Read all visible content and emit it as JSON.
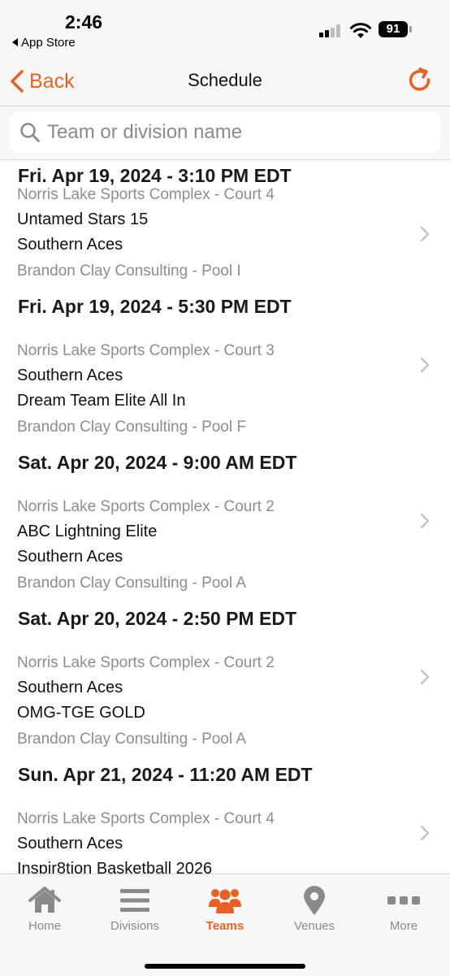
{
  "status_bar": {
    "time": "2:46",
    "back_app_label": "App Store",
    "battery": "91"
  },
  "nav": {
    "back_label": "Back",
    "title": "Schedule"
  },
  "search": {
    "placeholder": "Team or division name",
    "value": ""
  },
  "games": [
    {
      "datetime": "Fri. Apr 19, 2024 - 3:10 PM EDT",
      "venue": "Norris Lake Sports Complex - Court 4",
      "team1": "Untamed Stars 15",
      "team2": "Southern Aces",
      "pool": "Brandon Clay Consulting - Pool I"
    },
    {
      "datetime": "Fri. Apr 19, 2024 - 5:30 PM EDT",
      "venue": "Norris Lake Sports Complex - Court 3",
      "team1": "Southern Aces",
      "team2": "Dream Team Elite All In",
      "pool": "Brandon Clay Consulting - Pool F"
    },
    {
      "datetime": "Sat. Apr 20, 2024 - 9:00 AM EDT",
      "venue": "Norris Lake Sports Complex - Court 2",
      "team1": "ABC Lightning Elite",
      "team2": "Southern Aces",
      "pool": "Brandon Clay Consulting - Pool A"
    },
    {
      "datetime": "Sat. Apr 20, 2024 - 2:50 PM EDT",
      "venue": "Norris Lake Sports Complex - Court 2",
      "team1": "Southern Aces",
      "team2": "OMG-TGE GOLD",
      "pool": "Brandon Clay Consulting - Pool A"
    },
    {
      "datetime": "Sun. Apr 21, 2024 - 11:20 AM EDT",
      "venue": "Norris Lake Sports Complex - Court 4",
      "team1": "Southern Aces",
      "team2": "Inspir8tion Basketball 2026",
      "pool": ""
    }
  ],
  "tabs": [
    {
      "label": "Home",
      "icon": "home-icon",
      "active": false
    },
    {
      "label": "Divisions",
      "icon": "list-icon",
      "active": false
    },
    {
      "label": "Teams",
      "icon": "teams-icon",
      "active": true
    },
    {
      "label": "Venues",
      "icon": "map-pin-icon",
      "active": false
    },
    {
      "label": "More",
      "icon": "more-icon",
      "active": false
    }
  ],
  "colors": {
    "accent": "#ec5f22",
    "inactive": "#8a8a8a",
    "secondary_text": "#8d8d8d"
  }
}
